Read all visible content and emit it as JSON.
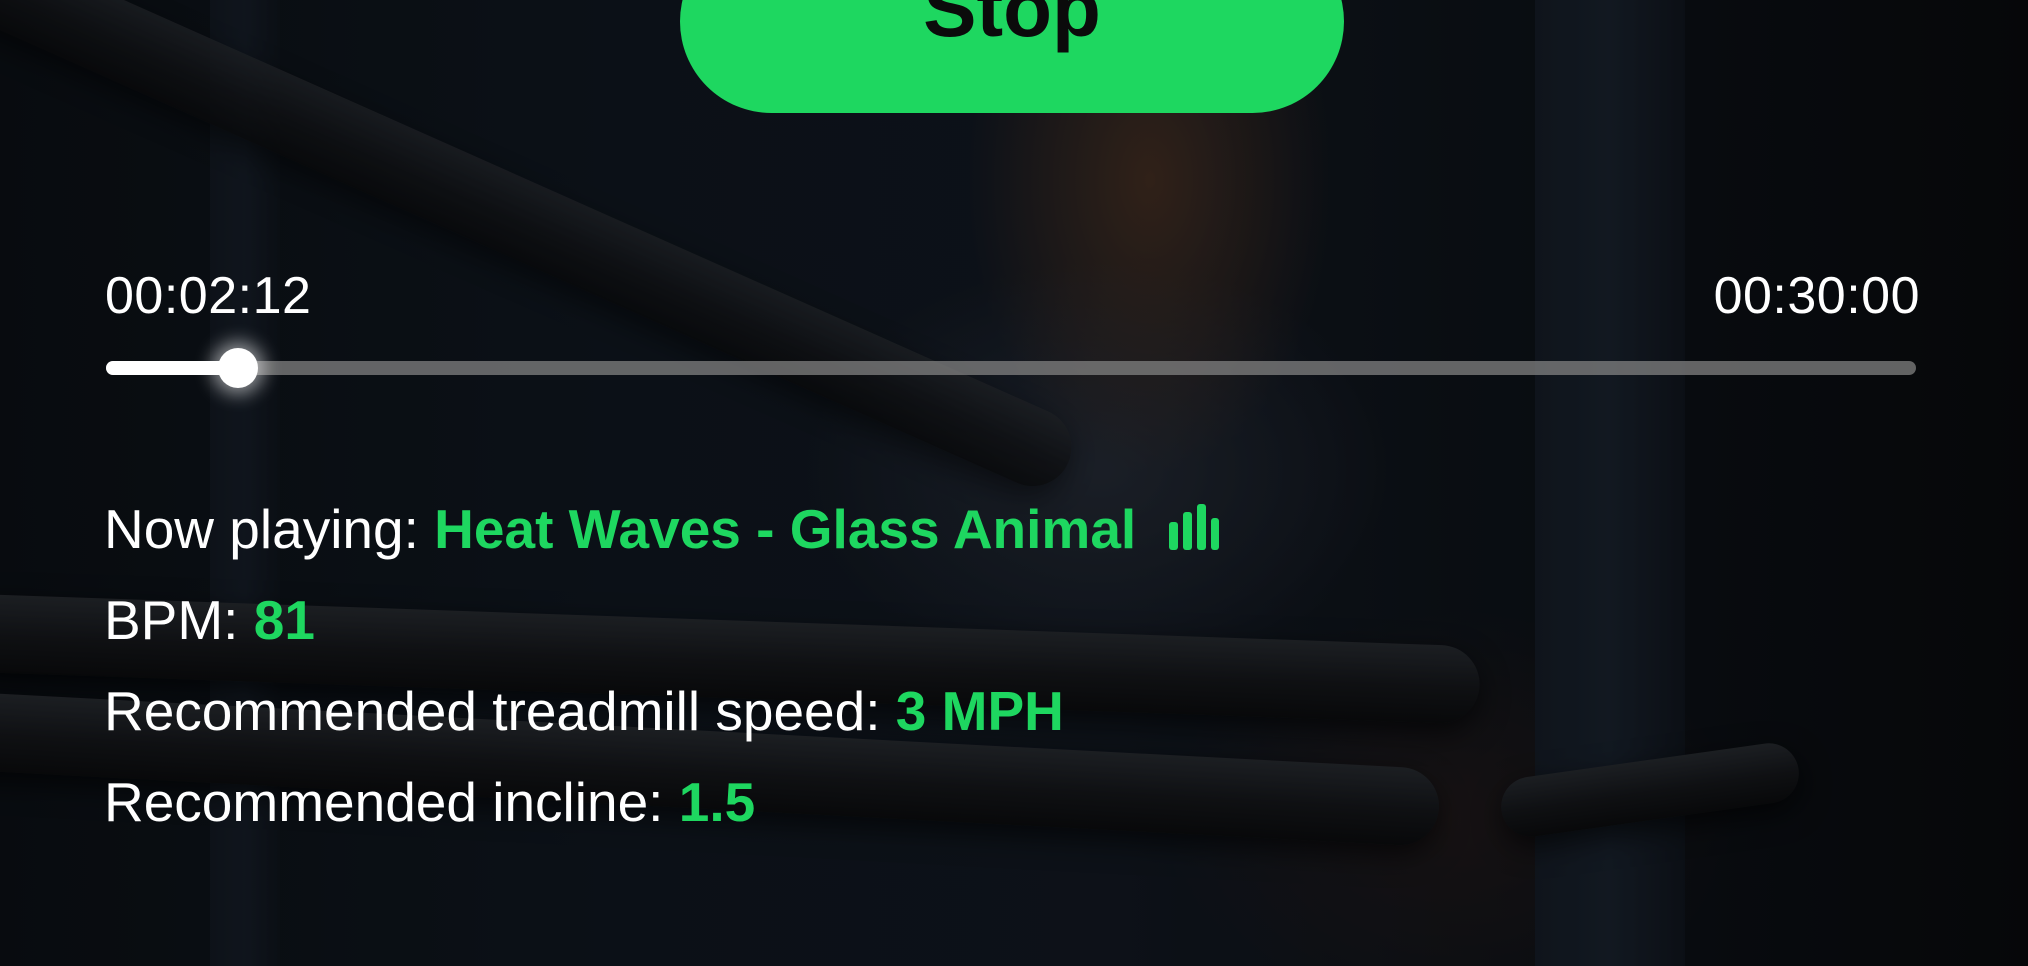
{
  "controls": {
    "stop_label": "Stop"
  },
  "timer": {
    "elapsed": "00:02:12",
    "total": "00:30:00",
    "progress": 0.073
  },
  "now_playing": {
    "label": "Now playing:",
    "track": "Heat Waves - Glass Animal",
    "icon": "equalizer-icon"
  },
  "bpm": {
    "label": "BPM:",
    "value": "81"
  },
  "speed": {
    "label": "Recommended treadmill speed:",
    "value": "3 MPH"
  },
  "incline": {
    "label": "Recommended incline:",
    "value": "1.5"
  },
  "colors": {
    "accent": "#1ed760",
    "text": "#ffffff",
    "track": "#828282"
  }
}
